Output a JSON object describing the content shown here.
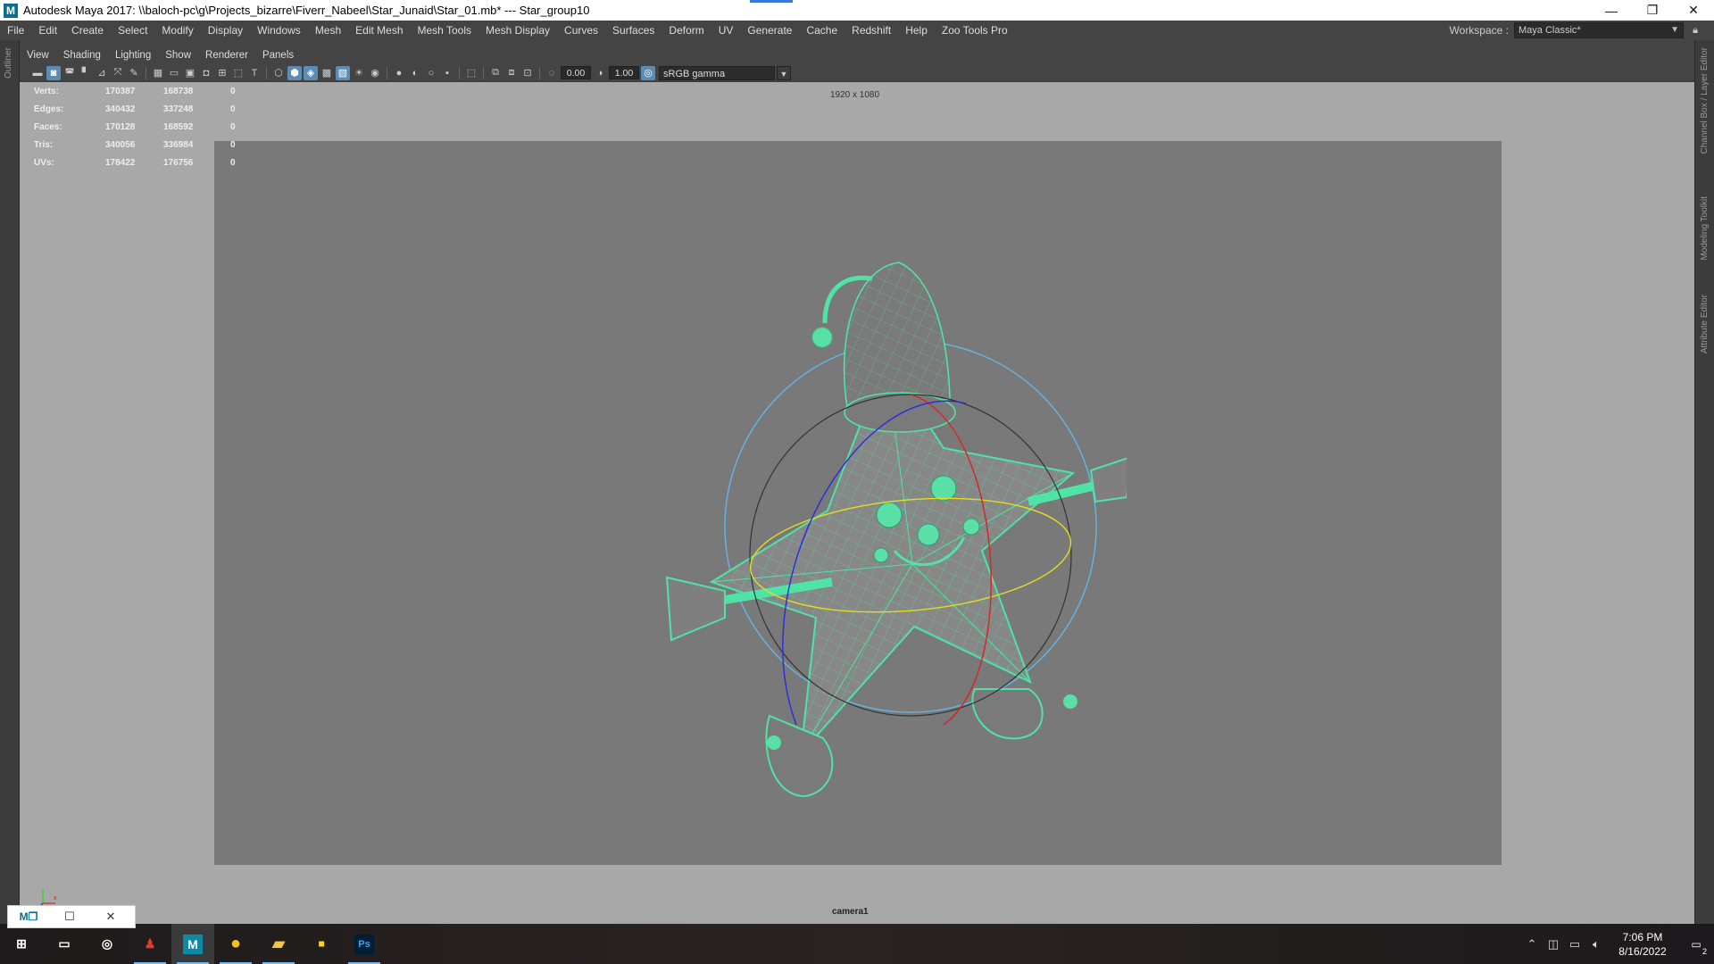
{
  "titlebar": {
    "app_logo": "M",
    "title": "Autodesk Maya 2017: \\\\baloch-pc\\g\\Projects_bizarre\\Fiverr_Nabeel\\Star_Junaid\\Star_01.mb*  ---  Star_group10",
    "controls": {
      "minimize": "—",
      "restore": "❐",
      "close": "✕"
    }
  },
  "menubar": {
    "items": [
      "File",
      "Edit",
      "Create",
      "Select",
      "Modify",
      "Display",
      "Windows",
      "Mesh",
      "Edit Mesh",
      "Mesh Tools",
      "Mesh Display",
      "Curves",
      "Surfaces",
      "Deform",
      "UV",
      "Generate",
      "Cache",
      "Redshift",
      "Help",
      "Zoo Tools Pro"
    ],
    "workspace_label": "Workspace :",
    "workspace_value": "Maya Classic*"
  },
  "side_labels": {
    "left": "Outliner",
    "right_1": "Channel Box / Layer Editor",
    "right_2": "Modeling Toolkit",
    "right_3": "Attribute Editor"
  },
  "panel_menu": {
    "items": [
      "View",
      "Shading",
      "Lighting",
      "Show",
      "Renderer",
      "Panels"
    ]
  },
  "panel_toolbar": {
    "exposure": "0.00",
    "gamma": "1.00",
    "color_space": "sRGB gamma"
  },
  "viewport": {
    "resolution": "1920 x 1080",
    "camera": "camera1",
    "hud": [
      {
        "label": "Verts:",
        "v1": "170387",
        "v2": "168738",
        "v3": "0"
      },
      {
        "label": "Edges:",
        "v1": "340432",
        "v2": "337248",
        "v3": "0"
      },
      {
        "label": "Faces:",
        "v1": "170128",
        "v2": "168592",
        "v3": "0"
      },
      {
        "label": "Tris:",
        "v1": "340056",
        "v2": "336984",
        "v3": "0"
      },
      {
        "label": "UVs:",
        "v1": "178422",
        "v2": "176756",
        "v3": "0"
      }
    ]
  },
  "taskbar": {
    "apps": [
      {
        "name": "start",
        "glyph": "⊞"
      },
      {
        "name": "task-view",
        "glyph": "▭"
      },
      {
        "name": "search",
        "glyph": "◎"
      },
      {
        "name": "app-red",
        "glyph": "♟"
      },
      {
        "name": "maya",
        "glyph": "M"
      },
      {
        "name": "chrome",
        "glyph": "●"
      },
      {
        "name": "file-explorer",
        "glyph": "▰"
      },
      {
        "name": "sticky-notes",
        "glyph": "▪"
      },
      {
        "name": "photoshop",
        "glyph": "Ps"
      }
    ],
    "clock_time": "7:06 PM",
    "clock_date": "8/16/2022",
    "notification_count": "2"
  }
}
